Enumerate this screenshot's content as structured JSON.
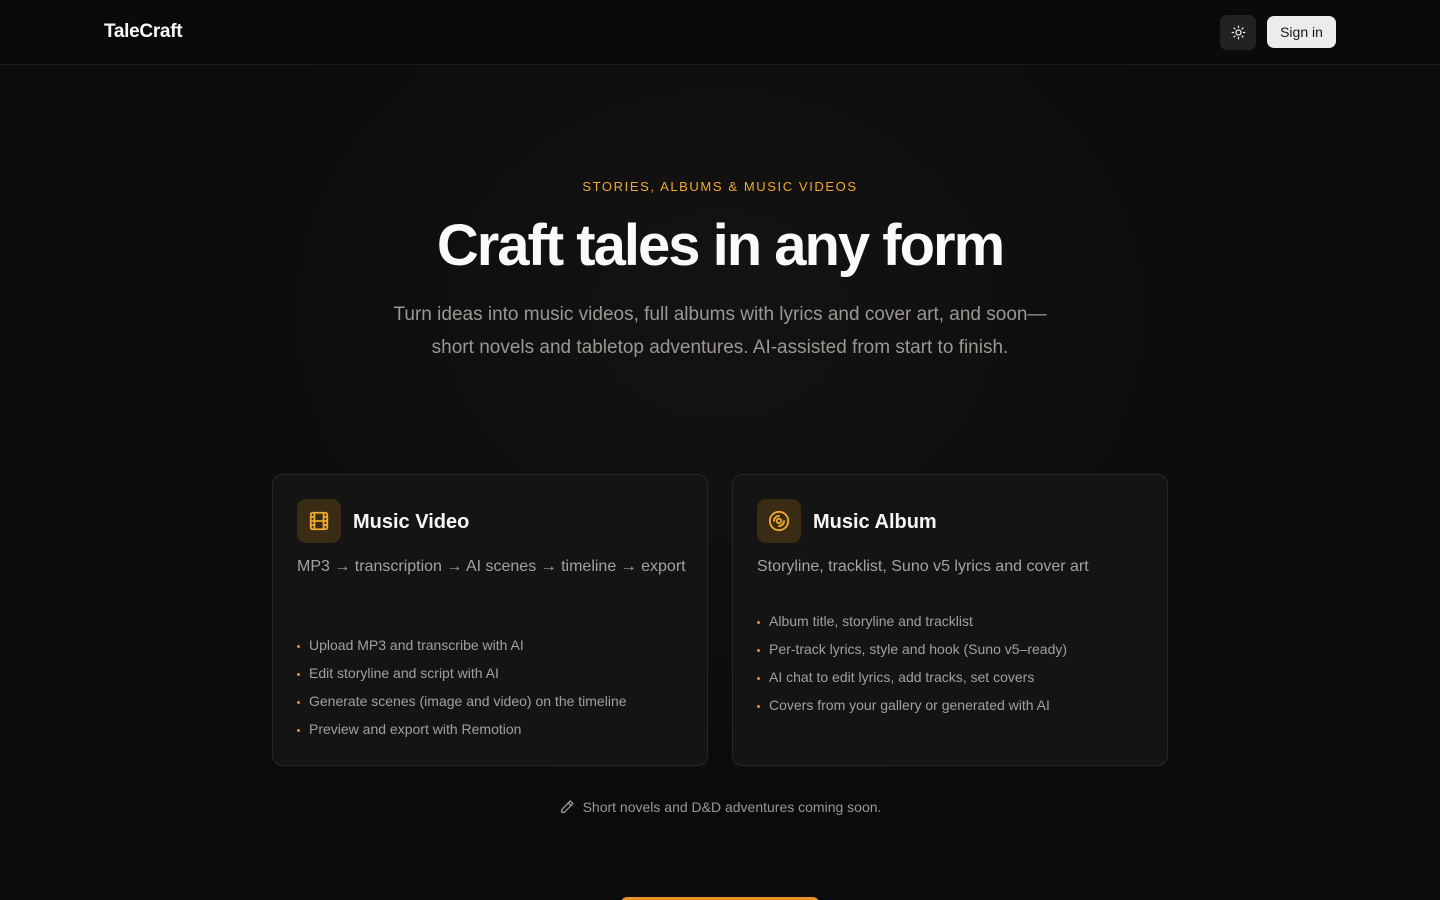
{
  "header": {
    "logo": "TaleCraft",
    "theme_toggle_icon": "sun-icon",
    "signin_label": "Sign in"
  },
  "hero": {
    "eyebrow": "STORIES, ALBUMS & MUSIC VIDEOS",
    "headline": "Craft tales in any form",
    "subhead_line1": "Turn ideas into music videos, full albums with lyrics and cover art, and soon—",
    "subhead_line2": "short novels and tabletop adventures. AI-assisted from start to finish."
  },
  "cards": [
    {
      "icon": "film-icon",
      "title": "Music Video",
      "description": "MP3 → transcription → AI scenes → timeline → export",
      "items": [
        "Upload MP3 and transcribe with AI",
        "Edit storyline and script with AI",
        "Generate scenes (image and video) on the timeline",
        "Preview and export with Remotion"
      ]
    },
    {
      "icon": "disc-icon",
      "title": "Music Album",
      "description": "Storyline, tracklist, Suno v5 lyrics and cover art",
      "items": [
        "Album title, storyline and tracklist",
        "Per-track lyrics, style and hook (Suno v5–ready)",
        "AI chat to edit lyrics, add tracks, set covers",
        "Covers from your gallery or generated with AI"
      ]
    }
  ],
  "coming_soon": {
    "icon": "pencil-icon",
    "text": "Short novels and D&D adventures coming soon."
  },
  "colors": {
    "accent": "#f0a92f",
    "background": "#0c0b0b",
    "card_background": "#141414"
  }
}
